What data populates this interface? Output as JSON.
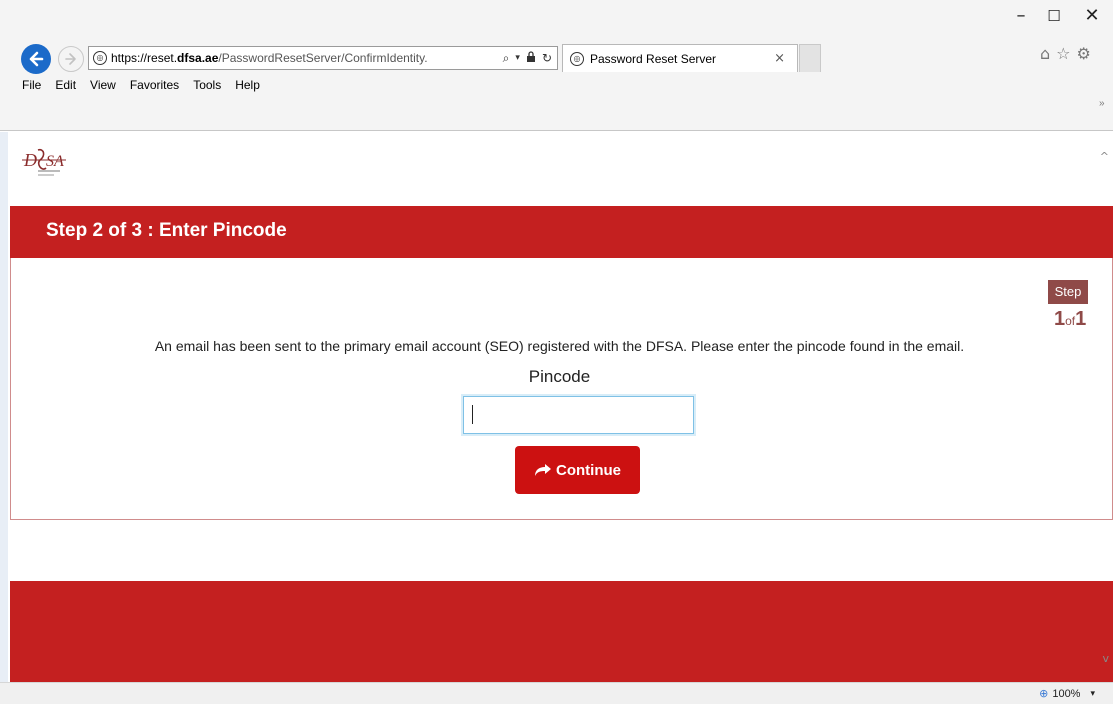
{
  "window": {
    "minimize_glyph": "–",
    "maximize_glyph": "☐",
    "close_glyph": "✕"
  },
  "browser": {
    "url_scheme": "https://reset.",
    "url_host": "dfsa.ae",
    "url_path": "/PasswordResetServer/ConfirmIdentity.",
    "tab_title": "Password Reset Server",
    "tab_close": "×",
    "menu": [
      "File",
      "Edit",
      "View",
      "Favorites",
      "Tools",
      "Help"
    ],
    "zoom": "100%"
  },
  "page": {
    "logo_text": "DfSA",
    "step_title": "Step 2 of 3 : Enter Pincode",
    "step_badge": "Step",
    "step_current": "1",
    "step_of": "of",
    "step_total": "1",
    "instruction": "An email has been sent to the primary email account (SEO) registered with the DFSA. Please enter the pincode found in the email.",
    "pincode_label": "Pincode",
    "pincode_value": "",
    "continue_label": "Continue"
  },
  "colors": {
    "brand_red": "#c42020",
    "button_red": "#cc1111",
    "step_badge": "#8f4a48",
    "ie_blue": "#1b6ac9"
  }
}
